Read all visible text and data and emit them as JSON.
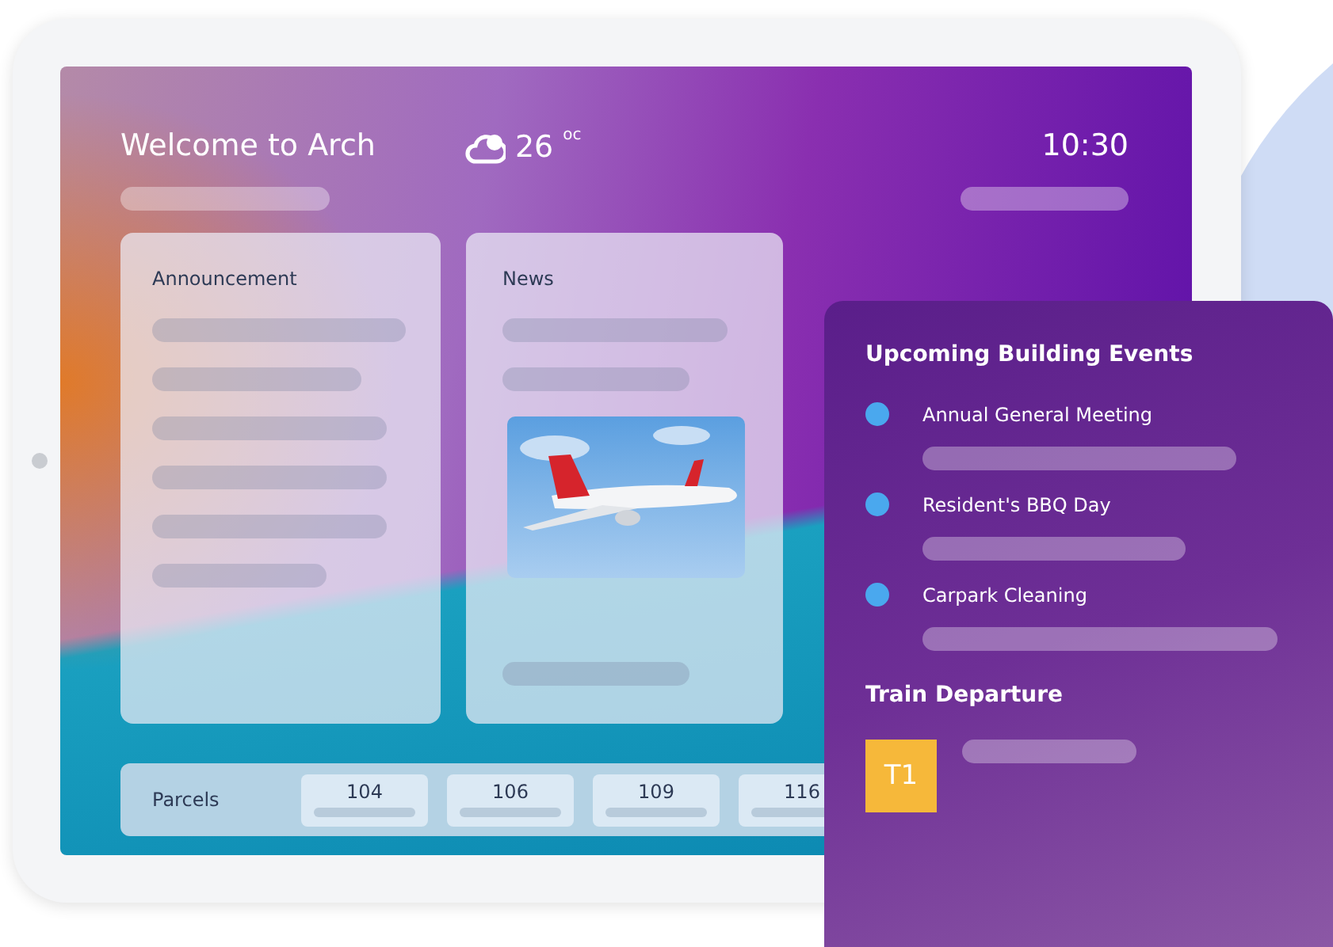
{
  "header": {
    "title": "Welcome to Arch",
    "temperature": "26",
    "unit": "oc",
    "time": "10:30"
  },
  "cards": [
    {
      "title": "Announcement",
      "kind": "text"
    },
    {
      "title": "News"
    }
  ],
  "parcels": {
    "label": "Parcels",
    "units": [
      "104",
      "106",
      "109",
      "116"
    ]
  },
  "events": {
    "title": "Upcoming Building Events",
    "items": [
      {
        "name": "Annual General Meeting",
        "color": "#4aa8ee"
      },
      {
        "name": "Resident's BBQ Day",
        "color": "#4aa8ee"
      },
      {
        "name": "Carpark Cleaning",
        "color": "#4aa8ee"
      }
    ]
  },
  "trains": {
    "title": "Train Departure",
    "badge": "T1"
  }
}
